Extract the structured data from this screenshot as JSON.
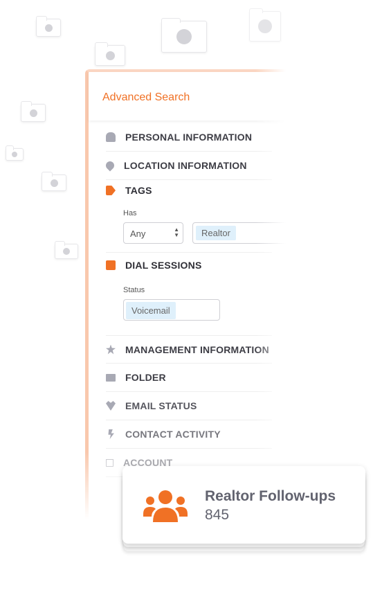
{
  "panel": {
    "title": "Advanced Search"
  },
  "sections": [
    {
      "label": "PERSONAL INFORMATION",
      "icon": "user-icon"
    },
    {
      "label": "LOCATION INFORMATION",
      "icon": "map-pin-icon"
    },
    {
      "label": "TAGS",
      "icon": "tag-icon"
    },
    {
      "label": "DIAL SESSIONS",
      "icon": "phone-icon"
    },
    {
      "label": "MANAGEMENT INFORMATION",
      "icon": "star-icon"
    },
    {
      "label": "FOLDER",
      "icon": "folder-icon"
    },
    {
      "label": "EMAIL STATUS",
      "icon": "heartbeat-icon"
    },
    {
      "label": "CONTACT ACTIVITY",
      "icon": "bolt-icon"
    },
    {
      "label": "ACCOUNT",
      "icon": "square-icon"
    }
  ],
  "tags": {
    "has_label": "Has",
    "has_value": "Any",
    "tag": "Realtor"
  },
  "dial": {
    "status_label": "Status",
    "status": "Voicemail"
  },
  "card": {
    "title": "Realtor Follow-ups",
    "count": "845",
    "icon": "users-icon"
  },
  "colors": {
    "accent": "#f07125",
    "chip": "#dff0fb",
    "icon_gray": "#a8a9b4"
  }
}
